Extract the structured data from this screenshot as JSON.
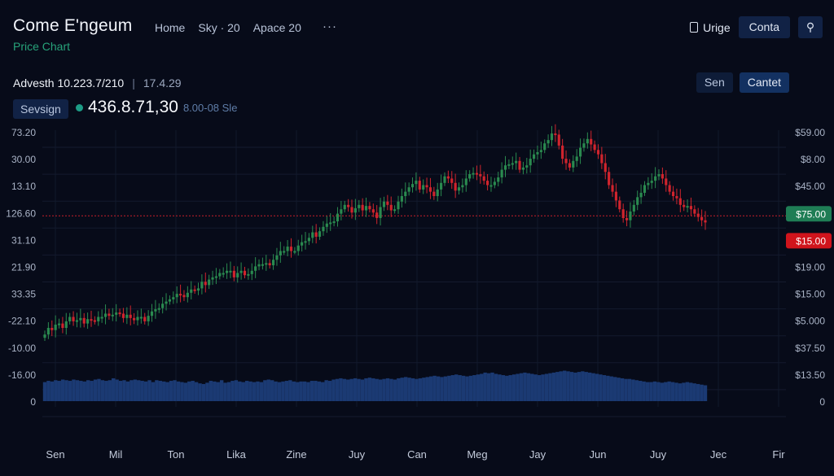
{
  "header": {
    "app_title": "Come E'ngeum",
    "subtitle": "Price Chart",
    "nav": [
      "Home",
      "Sky · 20",
      "Apace 20"
    ],
    "nav_more": "···",
    "user_label": "Urige",
    "contact_label": "Conta",
    "pin_label": "⚲"
  },
  "info": {
    "title": "Advesth 10.223.7/210",
    "separator": "|",
    "value": "17.4.29",
    "tag": "Sevsign",
    "price": "436.8.71,30",
    "price_sub": "8.00-08 Sle"
  },
  "actions": {
    "secondary": "Sen",
    "primary": "Cantet"
  },
  "colors": {
    "background": "#070b19",
    "up": "#2a8a4f",
    "down": "#d0242d",
    "volume": "#1b3a73",
    "marker_line": "#c81e2a",
    "accent_green": "#1d9c86"
  },
  "chart_data": {
    "type": "candlestick",
    "title": "",
    "xlabel": "",
    "ylabel": "",
    "grid": true,
    "x_ticks": [
      "Sen",
      "Mil",
      "Ton",
      "Lika",
      "Zine",
      "Juy",
      "Can",
      "Meg",
      "Jay",
      "Jun",
      "Juy",
      "Jec",
      "Fir"
    ],
    "left_ticks": [
      "73.20",
      "30.00",
      "13.10",
      "126.60",
      "31.10",
      "21.90",
      "33.35",
      "-22.10",
      "-10.00",
      "-16.00",
      "0"
    ],
    "right_ticks": [
      "$59.00",
      "$8.00",
      "$45.00",
      "$75.00",
      "$15.00",
      "$19.00",
      "$15.00",
      "$5.000",
      "$37.50",
      "$13.50",
      "0"
    ],
    "badges": [
      {
        "label": "$75.00",
        "color": "#1f7d55"
      },
      {
        "label": "$15.00",
        "color": "#d0141c"
      }
    ],
    "ylim": [
      0,
      10
    ],
    "marker_level": 6.1,
    "close": [
      0.7,
      1.0,
      0.9,
      1.15,
      1.2,
      1.0,
      1.3,
      1.5,
      1.3,
      1.35,
      1.45,
      1.2,
      1.4,
      1.35,
      1.3,
      1.5,
      1.5,
      1.65,
      1.55,
      1.6,
      1.7,
      1.65,
      1.45,
      1.6,
      1.45,
      1.35,
      1.5,
      1.5,
      1.3,
      1.55,
      1.75,
      1.85,
      1.9,
      2.1,
      2.2,
      2.3,
      2.4,
      2.55,
      2.5,
      2.4,
      2.6,
      2.75,
      2.7,
      2.8,
      3.1,
      2.95,
      3.2,
      3.3,
      3.35,
      3.5,
      3.5,
      3.6,
      3.6,
      3.3,
      3.5,
      3.6,
      3.4,
      3.45,
      3.6,
      3.8,
      3.9,
      3.9,
      3.95,
      3.85,
      4.1,
      4.3,
      4.5,
      4.5,
      4.7,
      4.5,
      4.5,
      4.75,
      4.9,
      4.95,
      5.1,
      5.35,
      5.15,
      5.4,
      5.6,
      5.75,
      5.8,
      5.85,
      6.2,
      6.4,
      6.6,
      6.5,
      6.25,
      6.45,
      6.6,
      6.35,
      6.55,
      6.4,
      6.25,
      6.0,
      6.5,
      6.75,
      6.6,
      6.35,
      6.4,
      6.75,
      7.0,
      7.2,
      7.4,
      7.55,
      7.7,
      7.3,
      7.5,
      7.4,
      7.2,
      7.0,
      7.3,
      7.6,
      7.9,
      7.8,
      7.6,
      7.25,
      7.4,
      7.5,
      7.8,
      8.0,
      8.05,
      8.0,
      7.9,
      7.7,
      7.5,
      7.5,
      7.65,
      7.85,
      8.2,
      8.4,
      8.45,
      8.5,
      8.6,
      8.2,
      8.3,
      8.4,
      8.7,
      8.9,
      9.0,
      9.1,
      9.4,
      9.55,
      9.85,
      9.8,
      9.3,
      8.7,
      8.5,
      8.3,
      8.6,
      8.8,
      9.2,
      9.4,
      9.6,
      9.35,
      9.1,
      8.9,
      8.5,
      8.1,
      7.5,
      7.2,
      6.8,
      6.4,
      6.0,
      5.9,
      6.3,
      6.6,
      6.95,
      7.15,
      7.5,
      7.6,
      7.7,
      7.9,
      8.0,
      7.8,
      7.5,
      7.2,
      7.0,
      6.9,
      6.6,
      6.5,
      6.55,
      6.4,
      6.2,
      6.05,
      5.9,
      5.8
    ],
    "volume": [
      3.0,
      3.2,
      3.1,
      3.3,
      3.2,
      3.4,
      3.3,
      3.2,
      3.4,
      3.3,
      3.2,
      3.1,
      3.3,
      3.2,
      3.4,
      3.5,
      3.3,
      3.2,
      3.3,
      3.6,
      3.4,
      3.2,
      3.3,
      3.1,
      3.3,
      3.4,
      3.3,
      3.2,
      3.1,
      3.3,
      3.0,
      3.3,
      3.2,
      3.1,
      3.0,
      3.2,
      3.3,
      3.1,
      3.0,
      2.9,
      3.1,
      3.2,
      3.0,
      2.8,
      2.7,
      2.9,
      3.2,
      3.1,
      3.0,
      3.3,
      2.9,
      3.0,
      3.2,
      3.3,
      3.1,
      3.0,
      3.2,
      3.1,
      3.0,
      3.1,
      3.0,
      3.3,
      3.4,
      3.3,
      3.1,
      3.0,
      3.1,
      3.2,
      3.3,
      3.1,
      3.0,
      3.1,
      3.1,
      3.0,
      3.2,
      3.2,
      3.1,
      3.0,
      3.3,
      3.2,
      3.4,
      3.5,
      3.6,
      3.5,
      3.4,
      3.5,
      3.6,
      3.5,
      3.4,
      3.6,
      3.7,
      3.6,
      3.5,
      3.4,
      3.5,
      3.6,
      3.5,
      3.4,
      3.6,
      3.7,
      3.8,
      3.7,
      3.6,
      3.5,
      3.6,
      3.7,
      3.8,
      3.9,
      4.0,
      3.9,
      3.8,
      3.9,
      4.0,
      4.1,
      4.2,
      4.1,
      4.0,
      3.9,
      4.0,
      4.1,
      4.2,
      4.3,
      4.5,
      4.4,
      4.5,
      4.3,
      4.2,
      4.1,
      4.0,
      4.1,
      4.2,
      4.3,
      4.4,
      4.5,
      4.4,
      4.3,
      4.2,
      4.1,
      4.2,
      4.3,
      4.4,
      4.5,
      4.6,
      4.7,
      4.8,
      4.7,
      4.6,
      4.5,
      4.6,
      4.7,
      4.6,
      4.5,
      4.4,
      4.3,
      4.2,
      4.1,
      4.0,
      3.9,
      3.8,
      3.7,
      3.6,
      3.5,
      3.5,
      3.4,
      3.3,
      3.2,
      3.1,
      3.0,
      3.0,
      3.1,
      3.0,
      2.9,
      3.0,
      3.1,
      3.0,
      2.9,
      2.8,
      2.9,
      3.0,
      2.9,
      2.8,
      2.7,
      2.6,
      2.5
    ]
  }
}
